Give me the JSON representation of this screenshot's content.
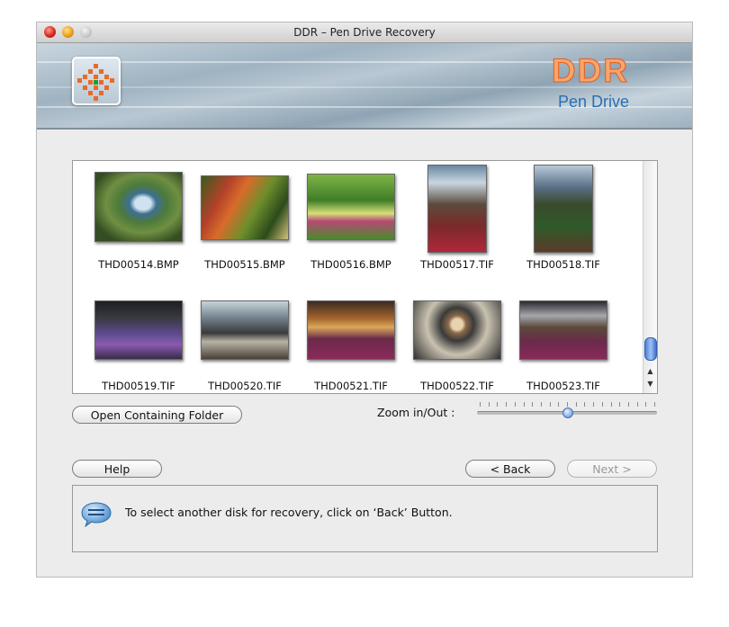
{
  "window": {
    "title": "DDR – Pen Drive Recovery"
  },
  "banner": {
    "brand": "DDR",
    "product": "Pen Drive"
  },
  "gallery": {
    "items": [
      {
        "name": "THD00514.BMP"
      },
      {
        "name": "THD00515.BMP"
      },
      {
        "name": "THD00516.BMP"
      },
      {
        "name": "THD00517.TIF"
      },
      {
        "name": "THD00518.TIF"
      },
      {
        "name": "THD00519.TIF"
      },
      {
        "name": "THD00520.TIF"
      },
      {
        "name": "THD00521.TIF"
      },
      {
        "name": "THD00522.TIF"
      },
      {
        "name": "THD00523.TIF"
      }
    ]
  },
  "buttons": {
    "open_folder": "Open Containing Folder",
    "help": "Help",
    "back": "< Back",
    "next": "Next >"
  },
  "zoom": {
    "label": "Zoom in/Out :",
    "level": 0.5
  },
  "info": {
    "message": "To select another disk for recovery, click on ‘Back’ Button."
  },
  "colors": {
    "brand_orange": "#f7a66a",
    "brand_blue": "#2a6fb3",
    "scroll_blue": "#4d7fd6"
  }
}
